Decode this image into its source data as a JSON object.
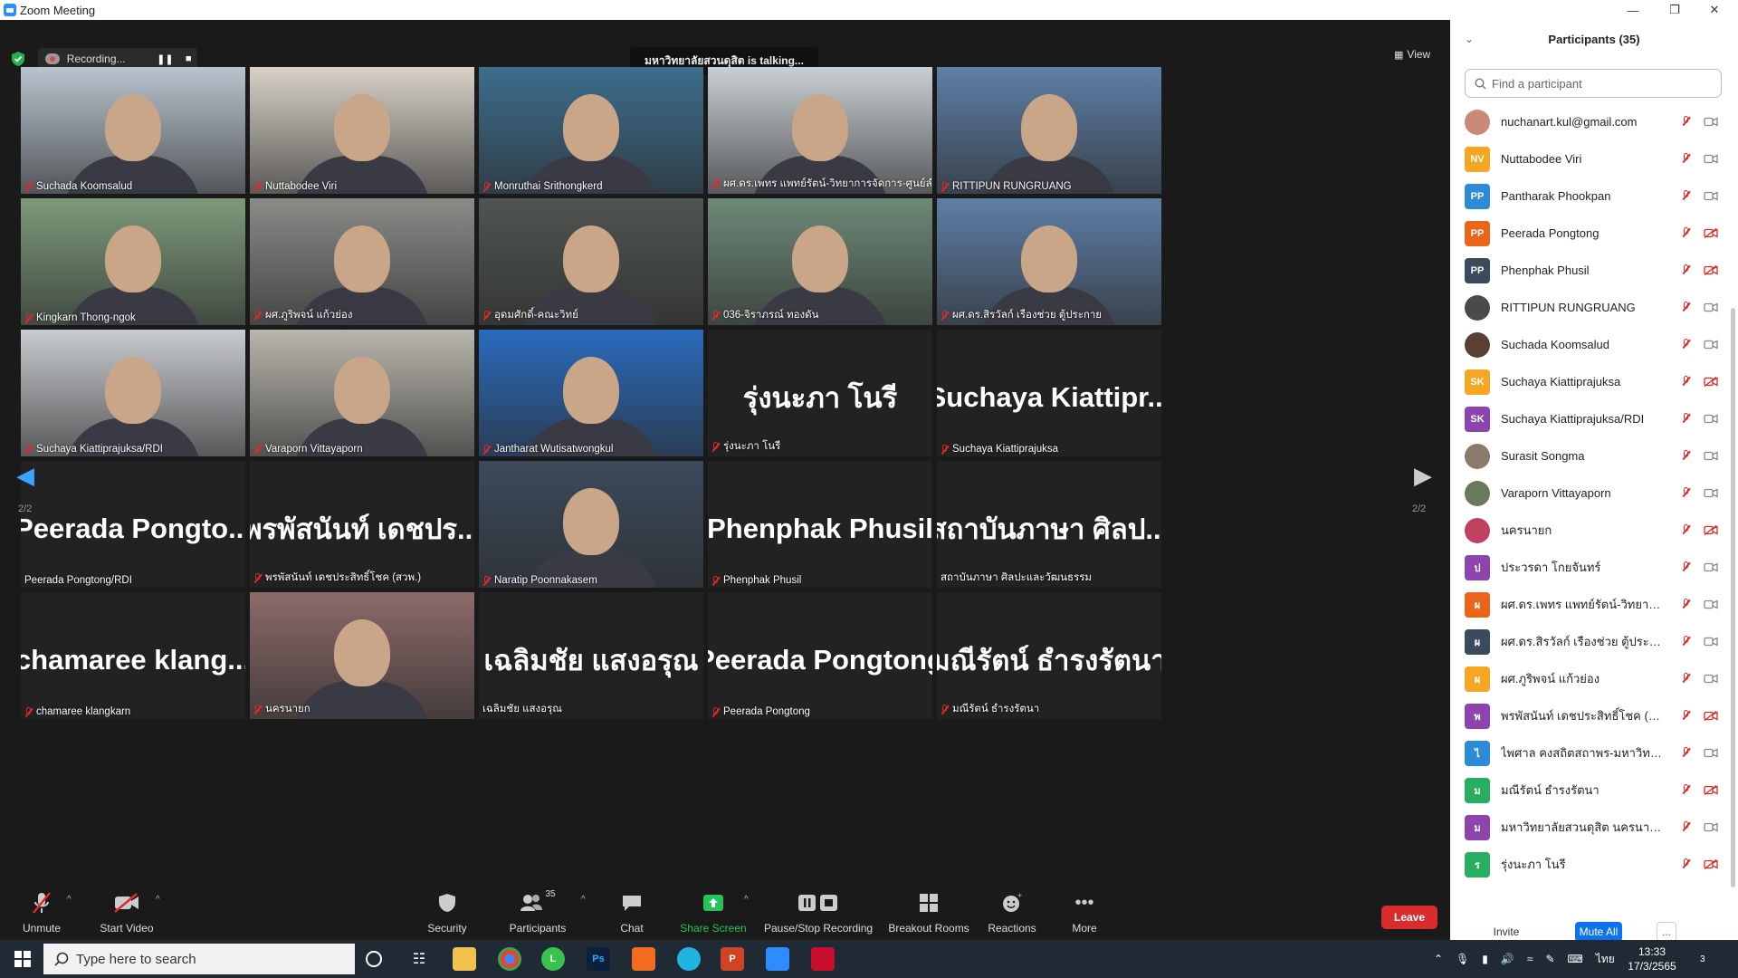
{
  "window": {
    "title": "Zoom Meeting"
  },
  "recording": {
    "label": "Recording..."
  },
  "talking": "มหาวิทยาลัยสวนดุสิต is talking...",
  "view_label": "View",
  "page_indicator": {
    "left": "2/2",
    "right": "2/2"
  },
  "tiles": [
    {
      "name": "Suchada Koomsalud",
      "type": "video",
      "muted": true,
      "bg": "#b9c4cf"
    },
    {
      "name": "Nuttabodee Viri",
      "type": "video",
      "muted": true,
      "bg": "#d8d2c8"
    },
    {
      "name": "Monruthai Srithongkerd",
      "type": "video",
      "muted": true,
      "bg": "#3d6e8e"
    },
    {
      "name": "ผศ.ดร.เพทร แพทย์รัตน์-วิทยาการจัดการ-ศูนย์ลำปาง",
      "type": "video",
      "muted": true,
      "bg": "#c9cfd3"
    },
    {
      "name": "RITTIPUN RUNGRUANG",
      "type": "video",
      "muted": true,
      "bg": "#5e7fa6"
    },
    {
      "name": "Kingkarn Thong-ngok",
      "type": "video",
      "muted": true,
      "bg": "#7d9a7a"
    },
    {
      "name": "ผศ.ภูริพจน์ แก้วย่อง",
      "type": "video",
      "muted": true,
      "bg": "#8a8c88"
    },
    {
      "name": "อุดมศักดิ์-คณะวิทย์",
      "type": "video",
      "muted": true,
      "bg": "#4f5550"
    },
    {
      "name": "036-จิราภรณ์ ทองดัน",
      "type": "video",
      "muted": true,
      "bg": "#6d8a78"
    },
    {
      "name": "ผศ.ดร.สิรวัลก์ เรืองช่วย ตู้ประกาย",
      "type": "video",
      "muted": true,
      "bg": "#5e7fa6"
    },
    {
      "name": "Suchaya Kiattiprajuksa/RDI",
      "type": "video",
      "muted": true,
      "bg": "#c9ccd0"
    },
    {
      "name": "Varaporn Vittayaporn",
      "type": "video",
      "muted": true,
      "bg": "#b9b6ad"
    },
    {
      "name": "Jantharat Wutisatwongkul",
      "type": "video",
      "muted": true,
      "bg": "#2a6bbd"
    },
    {
      "name": "รุ่งนะภา โนรี",
      "type": "text",
      "big": "รุ่งนะภา โนรี",
      "muted": true
    },
    {
      "name": "Suchaya Kiattiprajuksa",
      "type": "text",
      "big": "Suchaya Kiattipr...",
      "muted": true
    },
    {
      "name": "Peerada Pongtong/RDI",
      "type": "text",
      "big": "Peerada Pongto...",
      "muted": false
    },
    {
      "name": "พรพัสนันท์ เดชประสิทธิ์โชค (สวพ.)",
      "type": "text",
      "big": "พรพัสนันท์ เดชปร...",
      "muted": true
    },
    {
      "name": "Naratip Poonnakasem",
      "type": "video",
      "muted": true,
      "bg": "#3b4a5c"
    },
    {
      "name": "Phenphak Phusil",
      "type": "text",
      "big": "Phenphak Phusil",
      "muted": true
    },
    {
      "name": "สถาบันภาษา ศิลปะและวัฒนธรรม",
      "type": "text",
      "big": "สถาบันภาษา ศิลป...",
      "muted": false
    },
    {
      "name": "chamaree klangkarn",
      "type": "text",
      "big": "chamaree klang...",
      "muted": true
    },
    {
      "name": "นครนายก",
      "type": "video",
      "muted": true,
      "bg": "#8c6a6a"
    },
    {
      "name": "เฉลิมชัย แสงอรุณ",
      "type": "text",
      "big": "เฉลิมชัย แสงอรุณ",
      "muted": false
    },
    {
      "name": "Peerada Pongtong",
      "type": "text",
      "big": "Peerada Pongtong",
      "muted": true
    },
    {
      "name": "มณีรัตน์ ธำรงรัตนา",
      "type": "text",
      "big": "มณีรัตน์ ธำรงรัตนา",
      "muted": true
    }
  ],
  "toolbar": {
    "unmute": "Unmute",
    "start_video": "Start Video",
    "security": "Security",
    "participants": "Participants",
    "participants_count": "35",
    "chat": "Chat",
    "share_screen": "Share Screen",
    "pause_stop": "Pause/Stop Recording",
    "breakout": "Breakout Rooms",
    "reactions": "Reactions",
    "more": "More",
    "leave": "Leave"
  },
  "panel": {
    "title": "Participants (35)",
    "search_placeholder": "Find a participant",
    "invite": "Invite",
    "mute_all": "Mute All",
    "more": "...",
    "participants": [
      {
        "name": "nuchanart.kul@gmail.com",
        "initials": "",
        "color": "#c98a7a",
        "photo": true,
        "video_off": false
      },
      {
        "name": "Nuttabodee Viri",
        "initials": "NV",
        "color": "#f5a623",
        "photo": false,
        "video_off": false
      },
      {
        "name": "Pantharak Phookpan",
        "initials": "PP",
        "color": "#2d8cd8",
        "photo": false,
        "video_off": false
      },
      {
        "name": "Peerada Pongtong",
        "initials": "PP",
        "color": "#e8651a",
        "photo": false,
        "video_off": true
      },
      {
        "name": "Phenphak Phusil",
        "initials": "PP",
        "color": "#3b4a5c",
        "photo": false,
        "video_off": true
      },
      {
        "name": "RITTIPUN RUNGRUANG",
        "initials": "",
        "color": "#4a4a4a",
        "photo": true,
        "video_off": false
      },
      {
        "name": "Suchada Koomsalud",
        "initials": "",
        "color": "#5a4030",
        "photo": true,
        "video_off": false
      },
      {
        "name": "Suchaya Kiattiprajuksa",
        "initials": "SK",
        "color": "#f5a623",
        "photo": false,
        "video_off": true
      },
      {
        "name": "Suchaya Kiattiprajuksa/RDI",
        "initials": "SK",
        "color": "#8e44ad",
        "photo": false,
        "video_off": false
      },
      {
        "name": "Surasit Songma",
        "initials": "",
        "color": "#8a7a6a",
        "photo": true,
        "video_off": false
      },
      {
        "name": "Varaporn Vittayaporn",
        "initials": "",
        "color": "#6a7a5a",
        "photo": true,
        "video_off": false
      },
      {
        "name": "นครนายก",
        "initials": "",
        "color": "#c04060",
        "photo": true,
        "video_off": true
      },
      {
        "name": "ประวรดา โกยจันทร์",
        "initials": "ป",
        "color": "#8e44ad",
        "photo": false,
        "video_off": false
      },
      {
        "name": "ผศ.ดร.เพทร แพทย์รัตน์-วิทยาการจั...",
        "initials": "ผ",
        "color": "#e8651a",
        "photo": false,
        "video_off": false
      },
      {
        "name": "ผศ.ดร.สิรวัลก์ เรืองช่วย ตู้ประกาย",
        "initials": "ผ",
        "color": "#3b4a5c",
        "photo": false,
        "video_off": false
      },
      {
        "name": "ผศ.ภูริพจน์ แก้วย่อง",
        "initials": "ผ",
        "color": "#f5a623",
        "photo": false,
        "video_off": false
      },
      {
        "name": "พรพัสนันท์ เดชประสิทธิ์โชค (สวพ.)",
        "initials": "พ",
        "color": "#8e44ad",
        "photo": false,
        "video_off": true
      },
      {
        "name": "ไพศาล คงสถิตสถาพร-มหาวิทยาลัยส...",
        "initials": "ไ",
        "color": "#2d8cd8",
        "photo": false,
        "video_off": false
      },
      {
        "name": "มณีรัตน์ ธำรงรัตนา",
        "initials": "ม",
        "color": "#27ae60",
        "photo": false,
        "video_off": true
      },
      {
        "name": "มหาวิทยาลัยสวนดุสิต นครนายก",
        "initials": "ม",
        "color": "#8e44ad",
        "photo": false,
        "video_off": false
      },
      {
        "name": "รุ่งนะภา โนรี",
        "initials": "ร",
        "color": "#27ae60",
        "photo": false,
        "video_off": true
      }
    ]
  },
  "taskbar": {
    "search_placeholder": "Type here to search",
    "time": "13:33",
    "date": "17/3/2565",
    "lang": "ไทย",
    "notif": "3"
  }
}
